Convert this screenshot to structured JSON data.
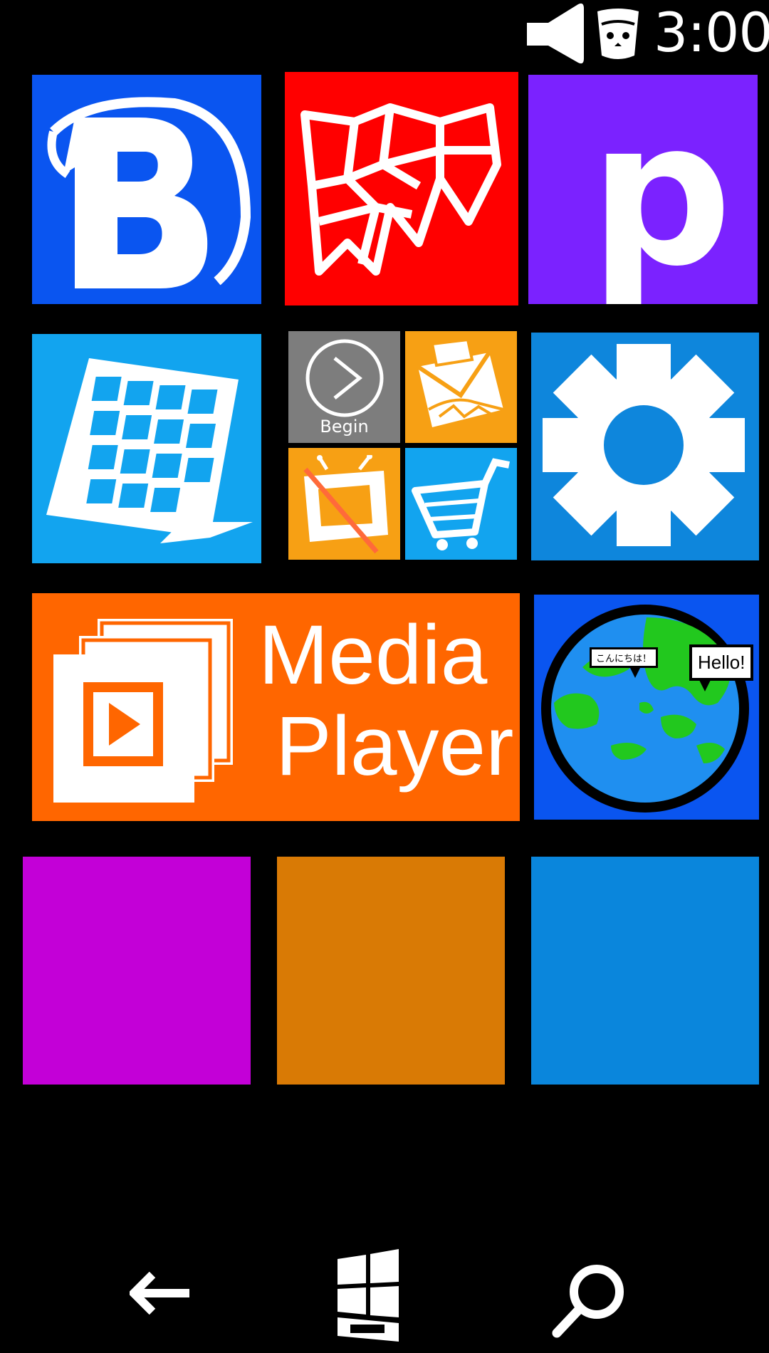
{
  "status_bar": {
    "time": "3:00",
    "volume_icon": "speaker-icon",
    "notification_icon": "face-cup-icon"
  },
  "tiles": {
    "browser": {
      "icon": "browser-b-globe-icon",
      "color": "#0a55f0"
    },
    "maps": {
      "icon": "folded-map-icon",
      "color": "#ff0000"
    },
    "p_app": {
      "icon": "p-letter",
      "letter": "p",
      "color": "#7b22ff"
    },
    "calculator": {
      "icon": "keypad-icon",
      "color": "#12a4ef"
    },
    "begin": {
      "icon": "play-circle-icon",
      "label": "Begin",
      "color": "#7d7d7d"
    },
    "mail": {
      "icon": "envelope-icon",
      "color": "#f7a014"
    },
    "tv": {
      "icon": "tv-icon",
      "color": "#f7a014"
    },
    "store": {
      "icon": "shopping-cart-icon",
      "color": "#12a4ef"
    },
    "settings": {
      "icon": "gear-icon",
      "color": "#0e86dc"
    },
    "media_player": {
      "icon": "media-player-icon",
      "line1": "Media",
      "line2": "Player",
      "color": "#ff6600"
    },
    "translator": {
      "icon": "globe-speech-icon",
      "bubble_ja": "こんにちは！",
      "bubble_en": "Hello!",
      "color": "#0a55f0"
    },
    "empty_magenta": {
      "color": "#c300d7"
    },
    "empty_orange": {
      "color": "#d97a05"
    },
    "empty_blue": {
      "color": "#0a86dc"
    }
  },
  "nav_bar": {
    "back": "back-arrow-icon",
    "start": "windows-logo-icon",
    "search": "magnifier-icon"
  }
}
